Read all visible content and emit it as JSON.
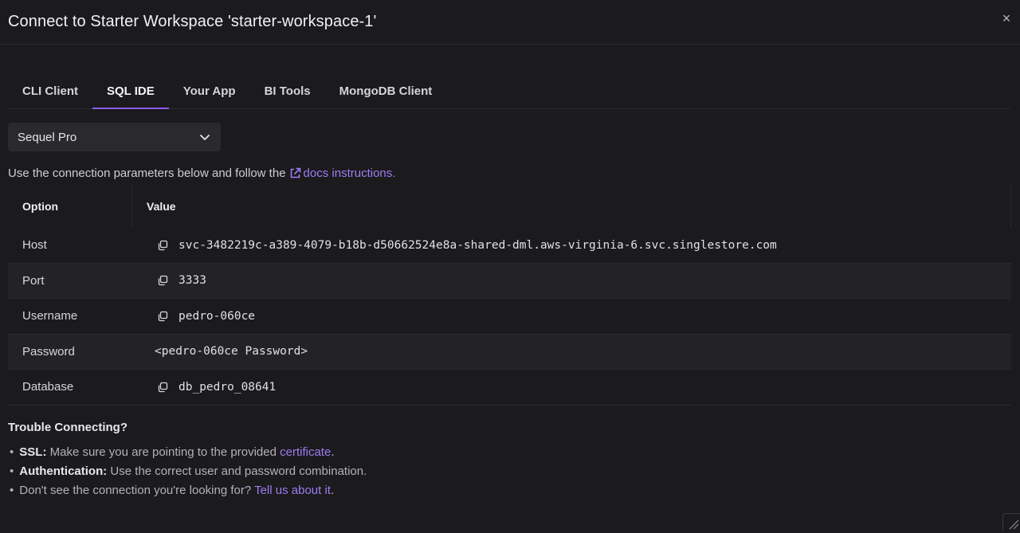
{
  "dialog": {
    "title": "Connect to Starter Workspace 'starter-workspace-1'",
    "close_glyph": "×"
  },
  "tabs": [
    {
      "label": "CLI Client",
      "active": false
    },
    {
      "label": "SQL IDE",
      "active": true
    },
    {
      "label": "Your App",
      "active": false
    },
    {
      "label": "BI Tools",
      "active": false
    },
    {
      "label": "MongoDB Client",
      "active": false
    }
  ],
  "ide_select": {
    "value": "Sequel Pro"
  },
  "intro": {
    "text": "Use the connection parameters below and follow the",
    "link": "docs instructions."
  },
  "table": {
    "headers": {
      "option": "Option",
      "value": "Value"
    },
    "rows": [
      {
        "option": "Host",
        "value": "svc-3482219c-a389-4079-b18b-d50662524e8a-shared-dml.aws-virginia-6.svc.singlestore.com",
        "copy": true
      },
      {
        "option": "Port",
        "value": "3333",
        "copy": true
      },
      {
        "option": "Username",
        "value": "pedro-060ce",
        "copy": true
      },
      {
        "option": "Password",
        "value": "<pedro-060ce Password>",
        "copy": false
      },
      {
        "option": "Database",
        "value": "db_pedro_08641",
        "copy": true
      }
    ]
  },
  "trouble": {
    "heading": "Trouble Connecting?",
    "tips": [
      {
        "bold": "SSL:",
        "text": " Make sure you are pointing to the provided ",
        "link": "certificate",
        "tail": "."
      },
      {
        "bold": "Authentication:",
        "text": " Use the correct user and password combination.",
        "link": "",
        "tail": ""
      },
      {
        "bold": "",
        "text": "Don't see the connection you're looking for? ",
        "link": "Tell us about it",
        "tail": "."
      }
    ]
  },
  "colors": {
    "accent": "#8b5cf6",
    "link": "#9d7df3",
    "background": "#1b1a1d"
  }
}
